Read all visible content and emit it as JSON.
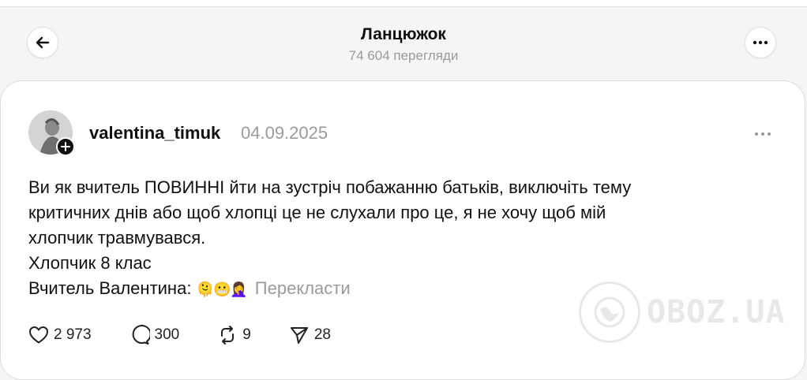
{
  "header": {
    "title": "Ланцюжок",
    "views": "74 604 перегляди"
  },
  "post": {
    "username": "valentina_timuk",
    "date": "04.09.2025",
    "lines": [
      "Ви як вчитель ПОВИННІ йти на зустріч побажанню батьків, виключіть тему",
      "критичних днів або щоб хлопці це не слухали про це, я не хочу щоб мій",
      "хлопчик травмувався.",
      "Хлопчик 8 клас"
    ],
    "last_line": "Вчитель Валентина: ",
    "emojis": "🫠😬🤦‍♀️",
    "translate_label": "Перекласти",
    "likes": "2 973",
    "comments": "300",
    "reposts": "9",
    "shares": "28"
  },
  "watermark": {
    "text": "OBOZ.UA"
  },
  "colors": {
    "muted": "#9a9a9a",
    "text": "#111111",
    "card_border": "#dcdcdc"
  },
  "icons": [
    "back-arrow-icon",
    "more-dots-icon",
    "plus-icon",
    "heart-icon",
    "comment-icon",
    "repost-icon",
    "share-icon"
  ]
}
